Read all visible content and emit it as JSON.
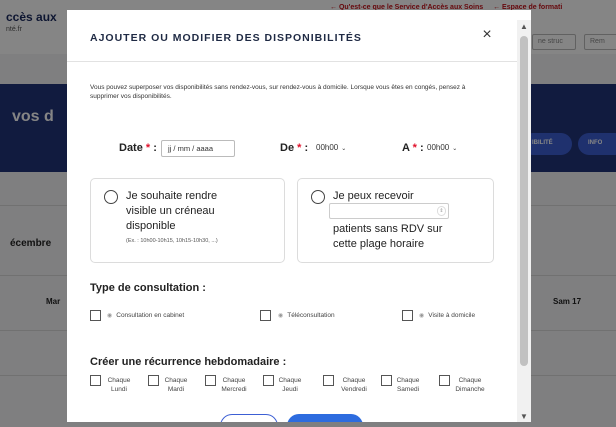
{
  "background": {
    "brand": "ccès aux",
    "brand_sub": "nté.fr",
    "top_links": [
      "← Qu'est-ce que le Service d'Accès aux Soins",
      "← Espace de formati"
    ],
    "tabs": [
      "ne struc",
      "Rem"
    ],
    "hero_title": "vos d",
    "pills": [
      "IBILITÉ",
      "INFO"
    ],
    "month": "écembre",
    "days": [
      "Mar",
      "Sam 17"
    ]
  },
  "modal": {
    "title": "AJOUTER OU MODIFIER DES DISPONIBILITÉS",
    "close_icon": "×",
    "intro": "Vous pouvez superposer vos disponibilités sans rendez-vous, sur rendez-vous à domicile. Lorsque vous êtes en congés, pensez à supprimer vos disponibilités.",
    "date": {
      "label": "Date",
      "required": "*",
      "colon": " :",
      "value": "jj / mm / aaaa"
    },
    "from": {
      "label": "De",
      "required": "*",
      "colon": " :",
      "value": "00h00"
    },
    "to": {
      "label": "A",
      "required": "*",
      "colon": " :",
      "value": "00h00"
    },
    "option_visible": {
      "lines": [
        "Je souhaite rendre",
        "visible un créneau",
        "disponible"
      ],
      "example": "(Ex. : 10h00-10h15, 10h15-10h30, ...)"
    },
    "option_receive": {
      "line1": "Je peux recevoir",
      "lines": [
        "patients sans RDV sur",
        "cette plage horaire"
      ]
    },
    "consultation": {
      "title": "Type de consultation :",
      "options": [
        "Consultation en cabinet",
        "Téléconsultation",
        "Visite à domicile"
      ]
    },
    "recurrence": {
      "title": "Créer une récurrence hebdomadaire :",
      "days": [
        {
          "top": "Chaque",
          "bottom": "Lundi"
        },
        {
          "top": "Chaque",
          "bottom": "Mardi"
        },
        {
          "top": "Chaque",
          "bottom": "Mercredi"
        },
        {
          "top": "Chaque",
          "bottom": "Jeudi"
        },
        {
          "top": "Chaque",
          "bottom": "Vendredi"
        },
        {
          "top": "Chaque",
          "bottom": "Samedi"
        },
        {
          "top": "Chaque",
          "bottom": "Dimanche"
        }
      ]
    },
    "scroll_up": "▲",
    "scroll_down": "▼",
    "caret": "⌄",
    "spin": "⇕",
    "consult_icon": "◉"
  }
}
